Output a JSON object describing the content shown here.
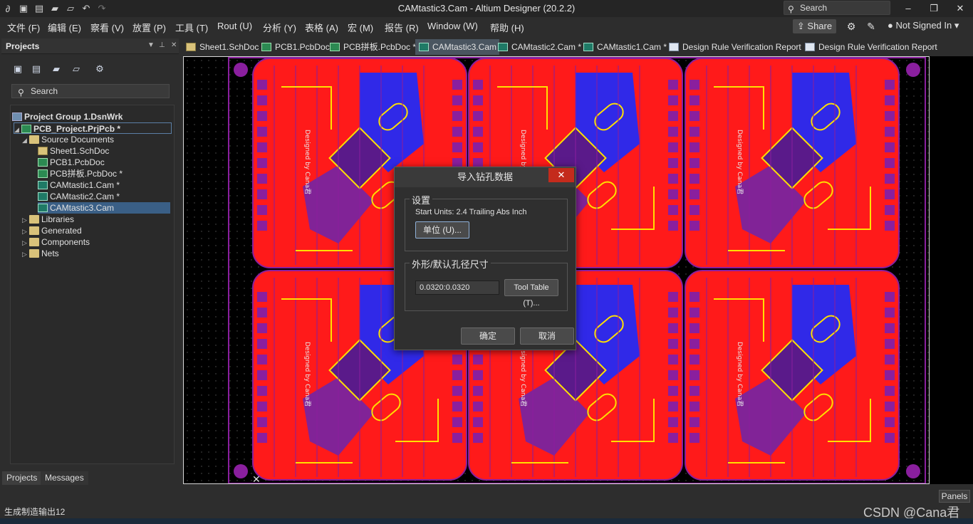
{
  "titlebar": {
    "title": "CAMtastic3.Cam - Altium Designer (20.2.2)",
    "search_placeholder": "Search"
  },
  "menu": {
    "items": [
      "文件 (F)",
      "编辑 (E)",
      "察看 (V)",
      "放置 (P)",
      "工具 (T)",
      "Rout (U)",
      "分析 (Y)",
      "表格 (A)",
      "宏 (M)",
      "报告 (R)",
      "Window (W)",
      "帮助 (H)"
    ],
    "share_label": "Share",
    "signed_label": "Not Signed In"
  },
  "projects": {
    "title": "Projects",
    "search_placeholder": "Search",
    "tree": [
      "Project Group 1.DsnWrk",
      "PCB_Project.PrjPcb *",
      "Source Documents",
      "Sheet1.SchDoc",
      "PCB1.PcbDoc",
      "PCB拼板.PcbDoc *",
      "CAMtastic1.Cam *",
      "CAMtastic2.Cam *",
      "CAMtastic3.Cam",
      "Libraries",
      "Generated",
      "Components",
      "Nets"
    ],
    "bottom_tabs": [
      "Projects",
      "Messages"
    ]
  },
  "doc_tabs": [
    "Sheet1.SchDoc",
    "PCB1.PcbDoc",
    "PCB拼板.PcbDoc *",
    "CAMtastic3.Cam",
    "CAMtastic2.Cam *",
    "CAMtastic1.Cam *",
    "Design Rule Verification Report",
    "Design Rule Verification Report"
  ],
  "canvas": {
    "board_text": "Designed by Cana君"
  },
  "dialog": {
    "title": "导入钻孔数据",
    "close": "✕",
    "settings_label": "设置",
    "start_units": "Start Units: 2.4 Trailing Abs Inch",
    "units_button": "单位 (U)...",
    "shape_label": "外形/默认孔径尺寸",
    "size_value": "0.0320:0.0320",
    "tool_table_button": "Tool Table (T)...",
    "ok": "确定",
    "cancel": "取消"
  },
  "status": {
    "text": "生成制造输出12",
    "panels": "Panels",
    "watermark": "CSDN @Cana君"
  },
  "colors": {
    "board_red": "#ff1a1a",
    "board_blue": "#1a2bff",
    "trace_yellow": "#ffe000",
    "pad_purple": "#8a1f9e"
  }
}
